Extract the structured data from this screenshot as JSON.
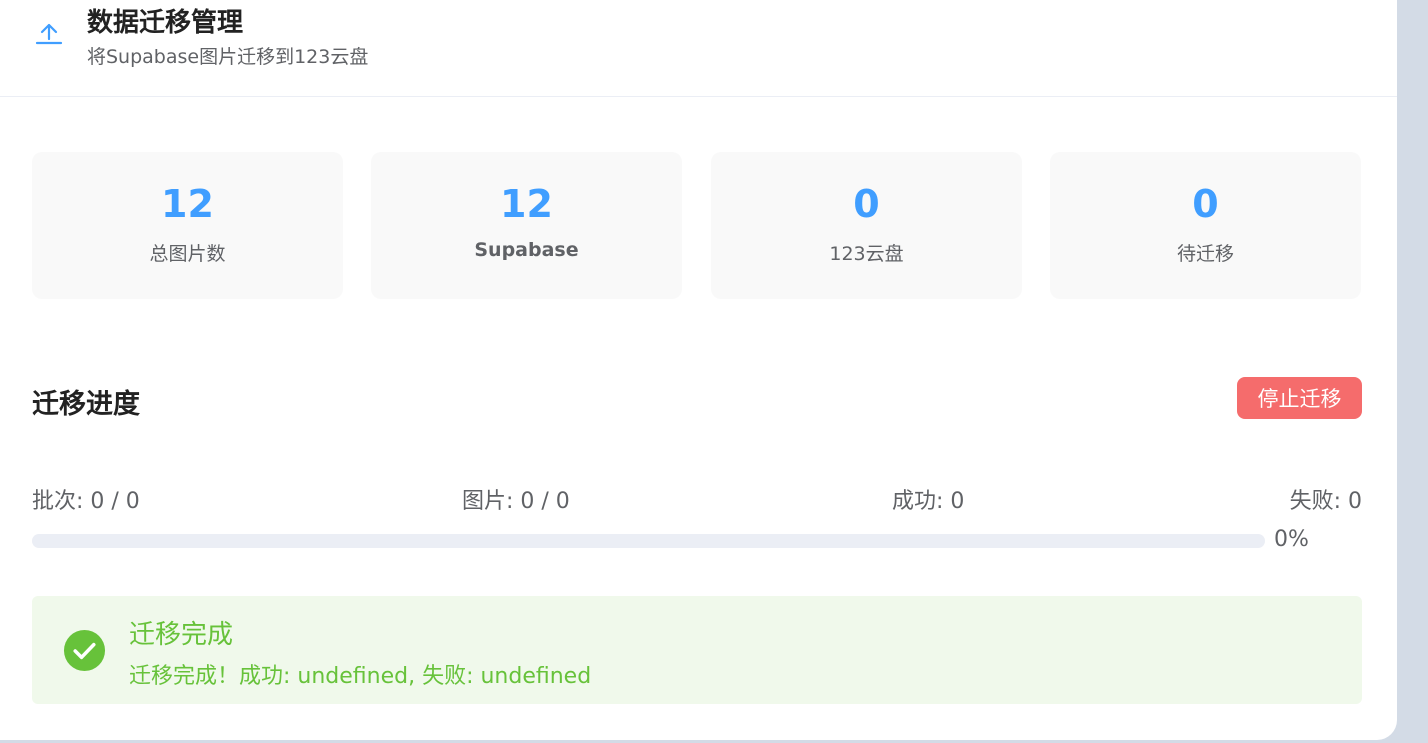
{
  "header": {
    "title": "数据迁移管理",
    "subtitle": "将Supabase图片迁移到123云盘",
    "icon": "upload-icon"
  },
  "stats": [
    {
      "value": "12",
      "label": "总图片数"
    },
    {
      "value": "12",
      "label": "Supabase"
    },
    {
      "value": "0",
      "label": "123云盘"
    },
    {
      "value": "0",
      "label": "待迁移"
    }
  ],
  "progress": {
    "section_title": "迁移进度",
    "stop_label": "停止迁移",
    "batch": "批次: 0 / 0",
    "images": "图片: 0 / 0",
    "success": "成功: 0",
    "failed": "失败: 0",
    "percent_value": 0,
    "percent_label": "0%"
  },
  "alert": {
    "title": "迁移完成",
    "description": "迁移完成！成功: undefined, 失败: undefined",
    "icon": "check-circle-icon"
  },
  "colors": {
    "accent": "#409eff",
    "danger": "#f56c6c",
    "success": "#67c23a",
    "success_bg": "#f0f9eb"
  }
}
